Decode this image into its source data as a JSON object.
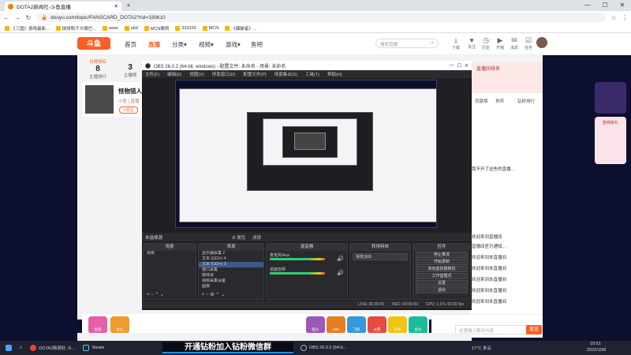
{
  "browser": {
    "tab_title": "DOTA2新闻社-斗鱼直播",
    "new_tab": "+",
    "win_min": "—",
    "win_max": "☐",
    "win_close": "✕",
    "url": "douyu.com/topic/FANSCARD_DOTA2?rid=339610",
    "bookmarks": [
      "《三国》游戏最新...",
      "烧饼鸭子大嘴巴...",
      "www",
      "ubd",
      "MCN案例",
      "333333",
      "MCN",
      "《爆破者》..."
    ]
  },
  "douyu": {
    "logo": "斗鱼",
    "nav": [
      "首页",
      "直播",
      "分类▾",
      "视频▾",
      "游戏▾",
      "鱼吧"
    ],
    "search_placeholder": "搜索直播",
    "top_icons": [
      {
        "icon": "download-icon",
        "label": "下载"
      },
      {
        "icon": "follow-icon",
        "label": "关注"
      },
      {
        "icon": "history-icon",
        "label": "历史"
      },
      {
        "icon": "open-icon",
        "label": "开播"
      },
      {
        "icon": "message-icon",
        "label": "消息"
      },
      {
        "icon": "task-icon",
        "label": "任务"
      }
    ],
    "rank_label": "日榜排名",
    "rank_value": "8",
    "rank_sub": "主播排行",
    "fans_value": "3",
    "fans_sub": "主播榜",
    "anchor_name": "怪物猎人",
    "anchor_tag": "斗鱼 | 直播",
    "follow_label": "V关注",
    "right_panel_title": "直播间排名",
    "right_tabs": [
      "贡献榜",
      "贵宾",
      "钻粉排行"
    ],
    "chat_lines": [
      {
        "user": "",
        "text": "我不开了这些的直播..."
      },
      {
        "user": "",
        "text": "欢迎来到直播间"
      },
      {
        "user": "",
        "text": "直播间官方通知..."
      },
      {
        "user": "",
        "text": "欢迎来到本直播间"
      },
      {
        "user": "",
        "text": "欢迎来到本直播间"
      },
      {
        "user": "",
        "text": "欢迎来到本直播间"
      },
      {
        "user": "",
        "text": "欢迎来到本直播间"
      },
      {
        "user": "",
        "text": "欢迎来到本直播间"
      }
    ],
    "chat_placeholder": "这里输入聊天内容",
    "send_label": "发送",
    "gift_labels": [
      "鱼翅",
      "鱼丸",
      "超火",
      "666",
      "飞机",
      "火箭",
      "奖杯",
      "鱼丸"
    ],
    "side_label": "签到有礼"
  },
  "obs": {
    "title": "OBS 26.0.2 (64-bit, windows) - 配置文件: 未命名 - 场景: 未命名",
    "menu": [
      "文件(F)",
      "编辑(E)",
      "视图(V)",
      "停靠窗口(D)",
      "配置文件(P)",
      "场景集合(S)",
      "工具(T)",
      "帮助(H)"
    ],
    "no_source": "未选择源",
    "properties": "⚙ 属性",
    "filters": "滤镜",
    "docks": {
      "scenes": {
        "title": "场景",
        "items": [
          "场景"
        ]
      },
      "sources": {
        "title": "来源",
        "items": [
          "显示器采集 2",
          "文本 (GDI+) 4",
          "文本 (GDI+) 3",
          "窗口采集",
          "媒体源",
          "视频采集设备",
          "图像"
        ]
      },
      "mixer": {
        "title": "混音器",
        "channels": [
          "麦克风/Aux",
          "桌面音频"
        ]
      },
      "transitions": {
        "title": "转场特效",
        "value": "渐变淡出"
      },
      "controls": {
        "title": "控件",
        "buttons": [
          "停止推流",
          "开始录制",
          "启动虚拟摄像机",
          "工作室模式",
          "设置",
          "退出"
        ]
      }
    },
    "status": [
      "LIVE: 00:00:00",
      "REC: 00:00:00",
      "CPU: 1.1%, 60.00 fps"
    ]
  },
  "taskbar": {
    "items": [
      "DOTA2新闻社-斗...",
      "Steam",
      "OBS 26.0.2 (64-b..."
    ],
    "banner": "开通钻粉加入钻粉微信群",
    "tray_weather": "17°C 多云",
    "time": "10:51",
    "date": "2022/10/6"
  }
}
